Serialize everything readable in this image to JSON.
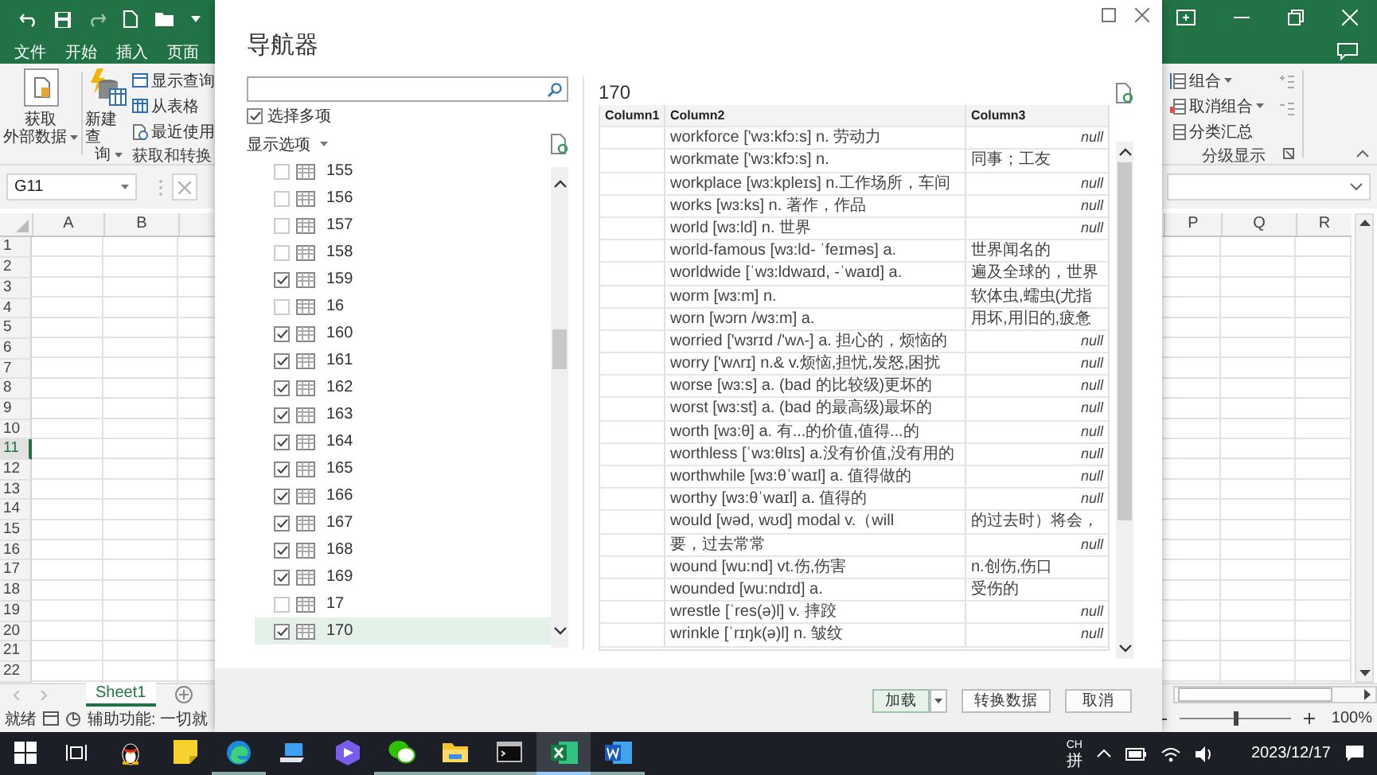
{
  "excel": {
    "quick_access": [
      {
        "kind": "undo"
      },
      {
        "kind": "save"
      },
      {
        "kind": "redo"
      },
      {
        "kind": "new"
      },
      {
        "kind": "open"
      },
      {
        "kind": "more"
      }
    ],
    "menu": [
      "文件",
      "开始",
      "插入",
      "页面"
    ],
    "ribbon": {
      "get_data": {
        "lines": [
          "获取",
          "外部数据"
        ]
      },
      "new_query": {
        "lines": [
          "新建查",
          "询"
        ]
      },
      "small": [
        {
          "kind": "show",
          "label": "显示查询"
        },
        {
          "kind": "table",
          "label": "从表格"
        },
        {
          "kind": "recent",
          "label": "最近使用"
        }
      ],
      "group_label": "获取和转换",
      "outline": {
        "items": [
          {
            "kind": "group",
            "label": "组合",
            "dropdown": true
          },
          {
            "kind": "ungroup",
            "label": "取消组合",
            "dropdown": true
          },
          {
            "kind": "subtotal",
            "label": "分类汇总",
            "dropdown": false
          }
        ],
        "group_label": "分级显示"
      }
    },
    "name_box": "G11",
    "columns_left": [
      "A",
      "B"
    ],
    "columns_right": [
      "P",
      "Q",
      "R"
    ],
    "rows": [
      {
        "label": "1",
        "selected": false
      },
      {
        "label": "2",
        "selected": false
      },
      {
        "label": "3",
        "selected": false
      },
      {
        "label": "4",
        "selected": false
      },
      {
        "label": "5",
        "selected": false
      },
      {
        "label": "6",
        "selected": false
      },
      {
        "label": "7",
        "selected": false
      },
      {
        "label": "8",
        "selected": false
      },
      {
        "label": "9",
        "selected": false
      },
      {
        "label": "10",
        "selected": false
      },
      {
        "label": "11",
        "selected": true
      },
      {
        "label": "12",
        "selected": false
      },
      {
        "label": "13",
        "selected": false
      },
      {
        "label": "14",
        "selected": false
      },
      {
        "label": "15",
        "selected": false
      },
      {
        "label": "16",
        "selected": false
      },
      {
        "label": "17",
        "selected": false
      },
      {
        "label": "18",
        "selected": false
      },
      {
        "label": "19",
        "selected": false
      },
      {
        "label": "20",
        "selected": false
      },
      {
        "label": "21",
        "selected": false
      },
      {
        "label": "22",
        "selected": false
      }
    ],
    "sheet_tabs": [
      {
        "label": "Sheet1",
        "selected": true
      }
    ],
    "status": {
      "ready": "就绪",
      "accessibility": "辅助功能: 一切就"
    },
    "zoom": {
      "level": 0.5,
      "reading": "100%"
    }
  },
  "navigator": {
    "title": "导航器",
    "select_multiple": {
      "label": "选择多项",
      "checked": true
    },
    "display_options": "显示选项",
    "items": [
      {
        "label": "155",
        "checked": false,
        "selected": false
      },
      {
        "label": "156",
        "checked": false,
        "selected": false
      },
      {
        "label": "157",
        "checked": false,
        "selected": false
      },
      {
        "label": "158",
        "checked": false,
        "selected": false
      },
      {
        "label": "159",
        "checked": true,
        "selected": false
      },
      {
        "label": "16",
        "checked": false,
        "selected": false
      },
      {
        "label": "160",
        "checked": true,
        "selected": false
      },
      {
        "label": "161",
        "checked": true,
        "selected": false
      },
      {
        "label": "162",
        "checked": true,
        "selected": false
      },
      {
        "label": "163",
        "checked": true,
        "selected": false
      },
      {
        "label": "164",
        "checked": true,
        "selected": false
      },
      {
        "label": "165",
        "checked": true,
        "selected": false
      },
      {
        "label": "166",
        "checked": true,
        "selected": false
      },
      {
        "label": "167",
        "checked": true,
        "selected": false
      },
      {
        "label": "168",
        "checked": true,
        "selected": false
      },
      {
        "label": "169",
        "checked": true,
        "selected": false
      },
      {
        "label": "17",
        "checked": false,
        "selected": false
      },
      {
        "label": "170",
        "checked": true,
        "selected": true
      }
    ],
    "preview": {
      "title": "170",
      "columns": [
        "Column1",
        "Column2",
        "Column3"
      ],
      "rows": [
        {
          "column2": "workforce ['wɜ:kfɔ:s] n. 劳动力",
          "column3": "null",
          "missing": true
        },
        {
          "column2": "workmate ['wɜ:kfɔ:s] n.",
          "column3": "同事；工友",
          "missing": false
        },
        {
          "column2": "workplace [wɜ:kpleɪs] n.工作场所，车间",
          "column3": "null",
          "missing": true
        },
        {
          "column2": "works [wɜ:ks] n. 著作，作品",
          "column3": "null",
          "missing": true
        },
        {
          "column2": "world [wɜ:ld] n. 世界",
          "column3": "null",
          "missing": true
        },
        {
          "column2": "world-famous [wɜ:ld- ˈfeɪməs] a.",
          "column3": "世界闻名的",
          "missing": false
        },
        {
          "column2": "worldwide [ˈwɜ:ldwaɪd, -ˈwaɪd] a.",
          "column3": "遍及全球的，世界",
          "missing": false
        },
        {
          "column2": "worm [wɜ:m] n.",
          "column3": "软体虫,蠕虫(尤指",
          "missing": false
        },
        {
          "column2": "worn [wɔrn /wɜ:m] a.",
          "column3": "用坏,用旧的,疲惫",
          "missing": false
        },
        {
          "column2": "worried ['wɜrɪd /'wʌ-] a. 担心的，烦恼的",
          "column3": "null",
          "missing": true
        },
        {
          "column2": "worry ['wʌrɪ] n.& v.烦恼,担忧,发怒,困扰",
          "column3": "null",
          "missing": true
        },
        {
          "column2": "worse [wɜ:s] a. (bad 的比较级)更坏的",
          "column3": "null",
          "missing": true
        },
        {
          "column2": "worst [wɜ:st] a. (bad 的最高级)最坏的",
          "column3": "null",
          "missing": true
        },
        {
          "column2": "worth [wɜ:θ] a. 有...的价值,值得...的",
          "column3": "null",
          "missing": true
        },
        {
          "column2": "worthless [ˈwɜ:θlɪs] a.没有价值,没有用的",
          "column3": "null",
          "missing": true
        },
        {
          "column2": "worthwhile [wɜ:θˈwaɪl] a. 值得做的",
          "column3": "null",
          "missing": true
        },
        {
          "column2": "worthy [wɜ:θˈwaɪl] a. 值得的",
          "column3": "null",
          "missing": true
        },
        {
          "column2": "would [wəd, wʊd] modal v.（will",
          "column3": "的过去时）将会，",
          "missing": false
        },
        {
          "column2": "要，过去常常",
          "column3": "null",
          "missing": true
        },
        {
          "column2": "wound [wu:nd] vt.伤,伤害",
          "column3": "n.创伤,伤口",
          "missing": false
        },
        {
          "column2": "wounded [wu:ndɪd] a.",
          "column3": "受伤的",
          "missing": false
        },
        {
          "column2": "wrestle [ˈres(ə)l] v. 摔跤",
          "column3": "null",
          "missing": true
        },
        {
          "column2": "wrinkle [ˈrɪŋk(ə)l] n. 皱纹",
          "column3": "null",
          "missing": true
        }
      ]
    },
    "buttons": [
      {
        "label": "加载",
        "default": true,
        "split": true
      },
      {
        "label": "转换数据",
        "default": false,
        "split": false
      },
      {
        "label": "取消",
        "default": false,
        "split": false
      }
    ]
  },
  "taskbar": {
    "apps": [
      {
        "kind": "start",
        "running": false,
        "active": false
      },
      {
        "kind": "taskview",
        "running": false,
        "active": false
      },
      {
        "kind": "penguin",
        "running": false,
        "active": false
      },
      {
        "kind": "note",
        "running": false,
        "active": false
      },
      {
        "kind": "browser",
        "running": true,
        "active": false
      },
      {
        "kind": "laptop",
        "running": false,
        "active": false
      },
      {
        "kind": "hexagon",
        "running": false,
        "active": false
      },
      {
        "kind": "chat",
        "running": true,
        "active": false
      },
      {
        "kind": "folder",
        "running": true,
        "active": false
      },
      {
        "kind": "terminal",
        "running": true,
        "active": false
      },
      {
        "kind": "sheet",
        "running": true,
        "active": true
      },
      {
        "kind": "doc",
        "running": true,
        "active": false
      }
    ],
    "input_top": "CH",
    "input_bottom": "拼",
    "date": "2023/12/17"
  }
}
